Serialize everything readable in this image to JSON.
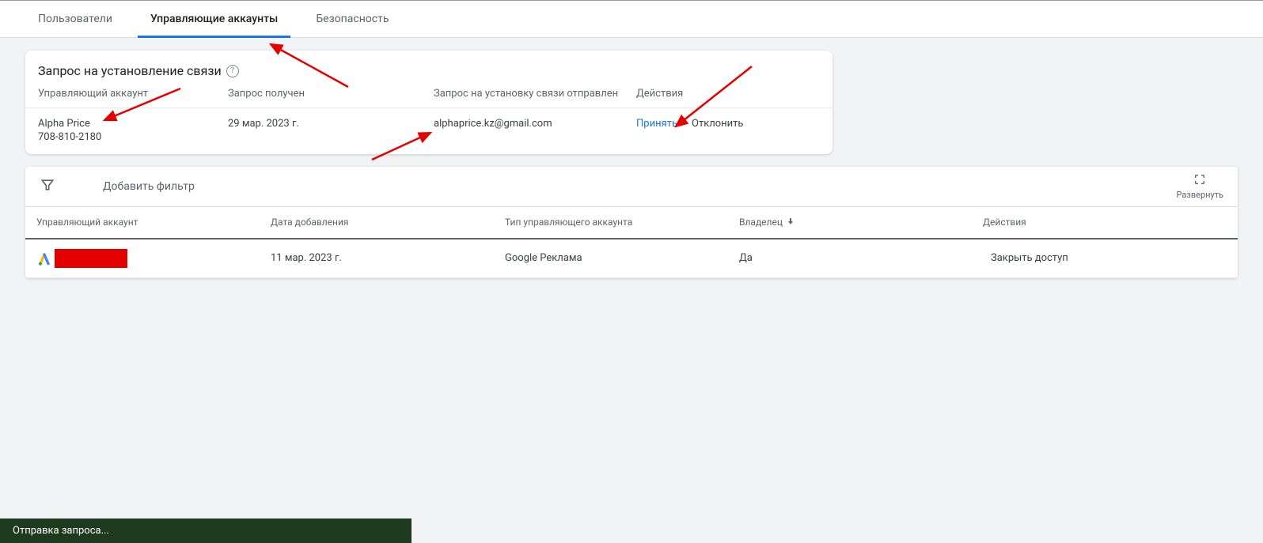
{
  "tabs": {
    "users": "Пользователи",
    "managers": "Управляющие аккаунты",
    "security": "Безопасность"
  },
  "request_card": {
    "title": "Запрос на установление связи",
    "header": {
      "manager": "Управляющий аккаунт",
      "received": "Запрос получен",
      "sent": "Запрос на установку связи отправлен",
      "actions": "Действия"
    },
    "row": {
      "account_name": "Alpha Price",
      "account_id": "708-810-2180",
      "received": "29 мар. 2023 г.",
      "sent": "alphaprice.kz@gmail.com",
      "accept": "Принять",
      "decline": "Отклонить"
    }
  },
  "toolbar": {
    "add_filter": "Добавить фильтр",
    "expand": "Развернуть"
  },
  "table": {
    "header": {
      "manager": "Управляющий аккаунт",
      "date": "Дата добавления",
      "type": "Тип управляющего аккаунта",
      "owner": "Владелец",
      "actions": "Действия"
    },
    "row": {
      "date": "11 мар. 2023 г.",
      "type": "Google Реклама",
      "owner": "Да",
      "action": "Закрыть доступ"
    }
  },
  "status": "Отправка запроса..."
}
